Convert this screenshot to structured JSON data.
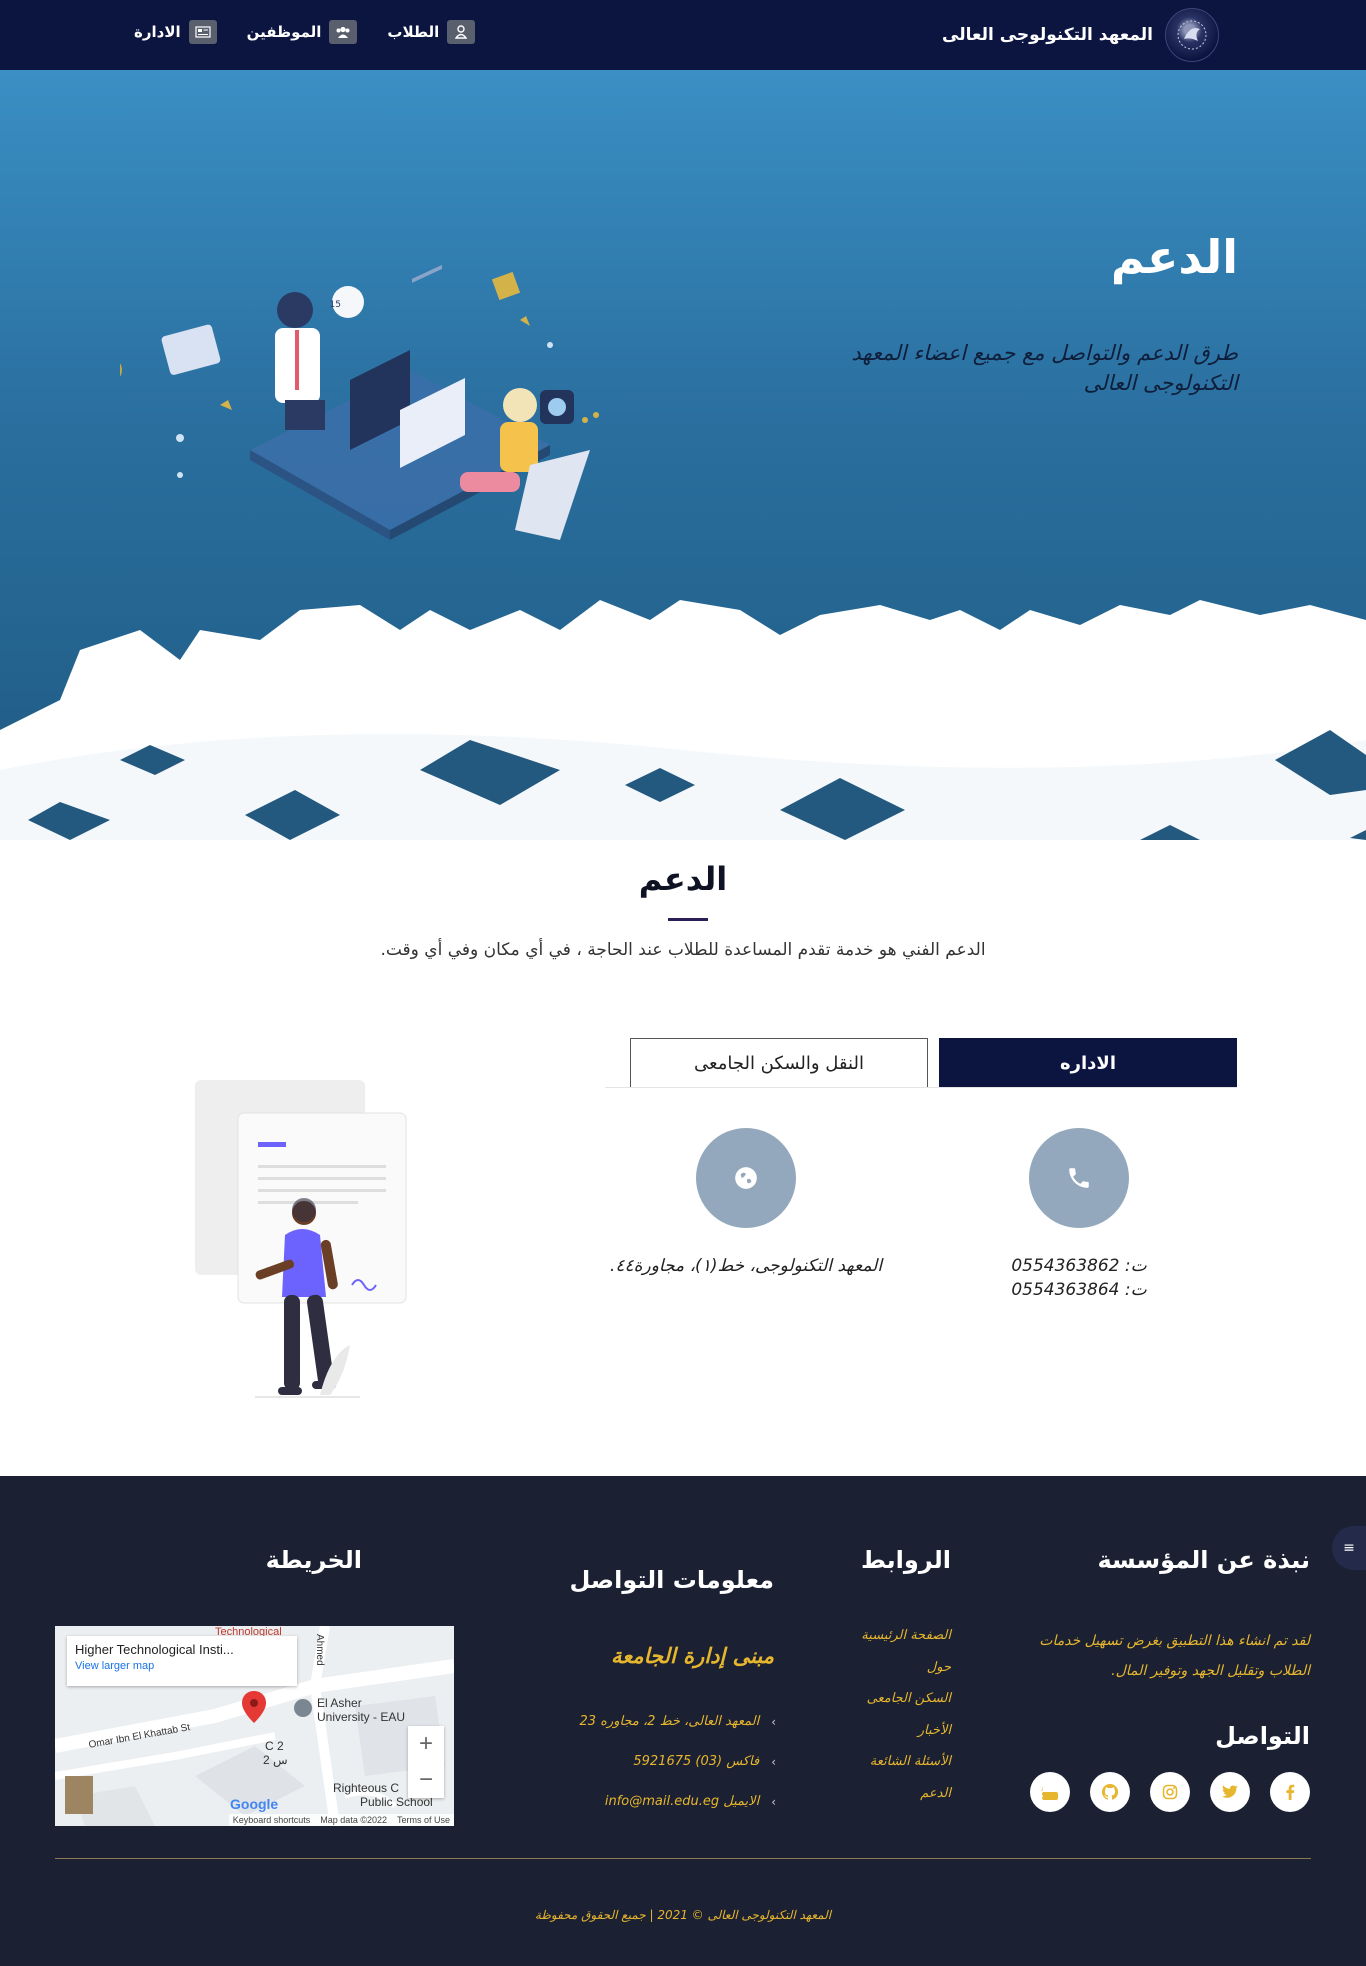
{
  "navbar": {
    "brand_title": "المعهد التكنولوجى العالى",
    "links": [
      {
        "label": "الطلاب",
        "icon": "user-icon"
      },
      {
        "label": "الموظفين",
        "icon": "users-icon"
      },
      {
        "label": "الادارة",
        "icon": "id-card-icon"
      }
    ]
  },
  "hero": {
    "title": "الدعم",
    "subtitle": "طرق الدعم والتواصل مع جميع اعضاء المعهد التكنولوجى العالى"
  },
  "support": {
    "title": "الدعم",
    "description": "الدعم الفني هو خدمة تقدم المساعدة للطلاب عند الحاجة ، في أي مكان وفي أي وقت.",
    "tabs": {
      "active": "الاداره",
      "inactive": "النقل والسكن الجامعى"
    },
    "phone_card": {
      "icon": "phone-icon",
      "line1": "ت: 0554363862",
      "line2": "ت: 0554363864"
    },
    "address_card": {
      "icon": "globe-icon",
      "text": "المعهد التكنولوجى، خط(١)، مجاورة٤٤."
    }
  },
  "footer": {
    "about_title": "نبذة عن المؤسسة",
    "about_text": "لقد تم انشاء هذا التطبيق بغرض تسهيل خدمات الطلاب وتقليل الجهد وتوفير المال.",
    "social_title": "التواصل",
    "social": [
      "facebook-icon",
      "twitter-icon",
      "instagram-icon",
      "github-icon",
      "youtube-icon"
    ],
    "links_title": "الروابط",
    "links": [
      "الصفحة الرئيسية",
      "حول",
      "السكن الجامعى",
      "الأخبار",
      "الأسئلة الشائعة",
      "الدعم"
    ],
    "contact_title": "معلومات التواصل",
    "contact_sub": "مبنى إدارة الجامعة",
    "contact_items": [
      "المعهد العالى، خط 2، مجاوره 23",
      "فاكس (03) 5921675",
      "الايميل info@mail.edu.eg"
    ],
    "map_title": "الخريطة",
    "map": {
      "place": "Higher Technological Insti...",
      "larger_link": "View larger map",
      "top_label": "Technological",
      "road_right": "Ahmed",
      "poi1": "El Asher",
      "poi1b": "University - EAU",
      "road": "Omar Ibn El Khattab St",
      "block": "C 2",
      "block_ar": "س 2",
      "poi2": "Righteous C",
      "poi2b": "Public School",
      "zoom_in": "+",
      "zoom_out": "−",
      "google": "Google",
      "shortcuts": "Keyboard shortcuts",
      "mapdata": "Map data ©2022",
      "terms": "Terms of Use"
    },
    "copyright": "المعهد التكنولوجى العالى © 2021 | جميع الحقوق محفوظة",
    "side_tab_icon": "≡"
  },
  "colors": {
    "navbar": "#0c1440",
    "hero_top": "#3a8fc4",
    "hero_bottom": "#1f5a82",
    "footer": "#1b2032",
    "accent": "#e6b62e",
    "circle": "#94a8bd"
  }
}
